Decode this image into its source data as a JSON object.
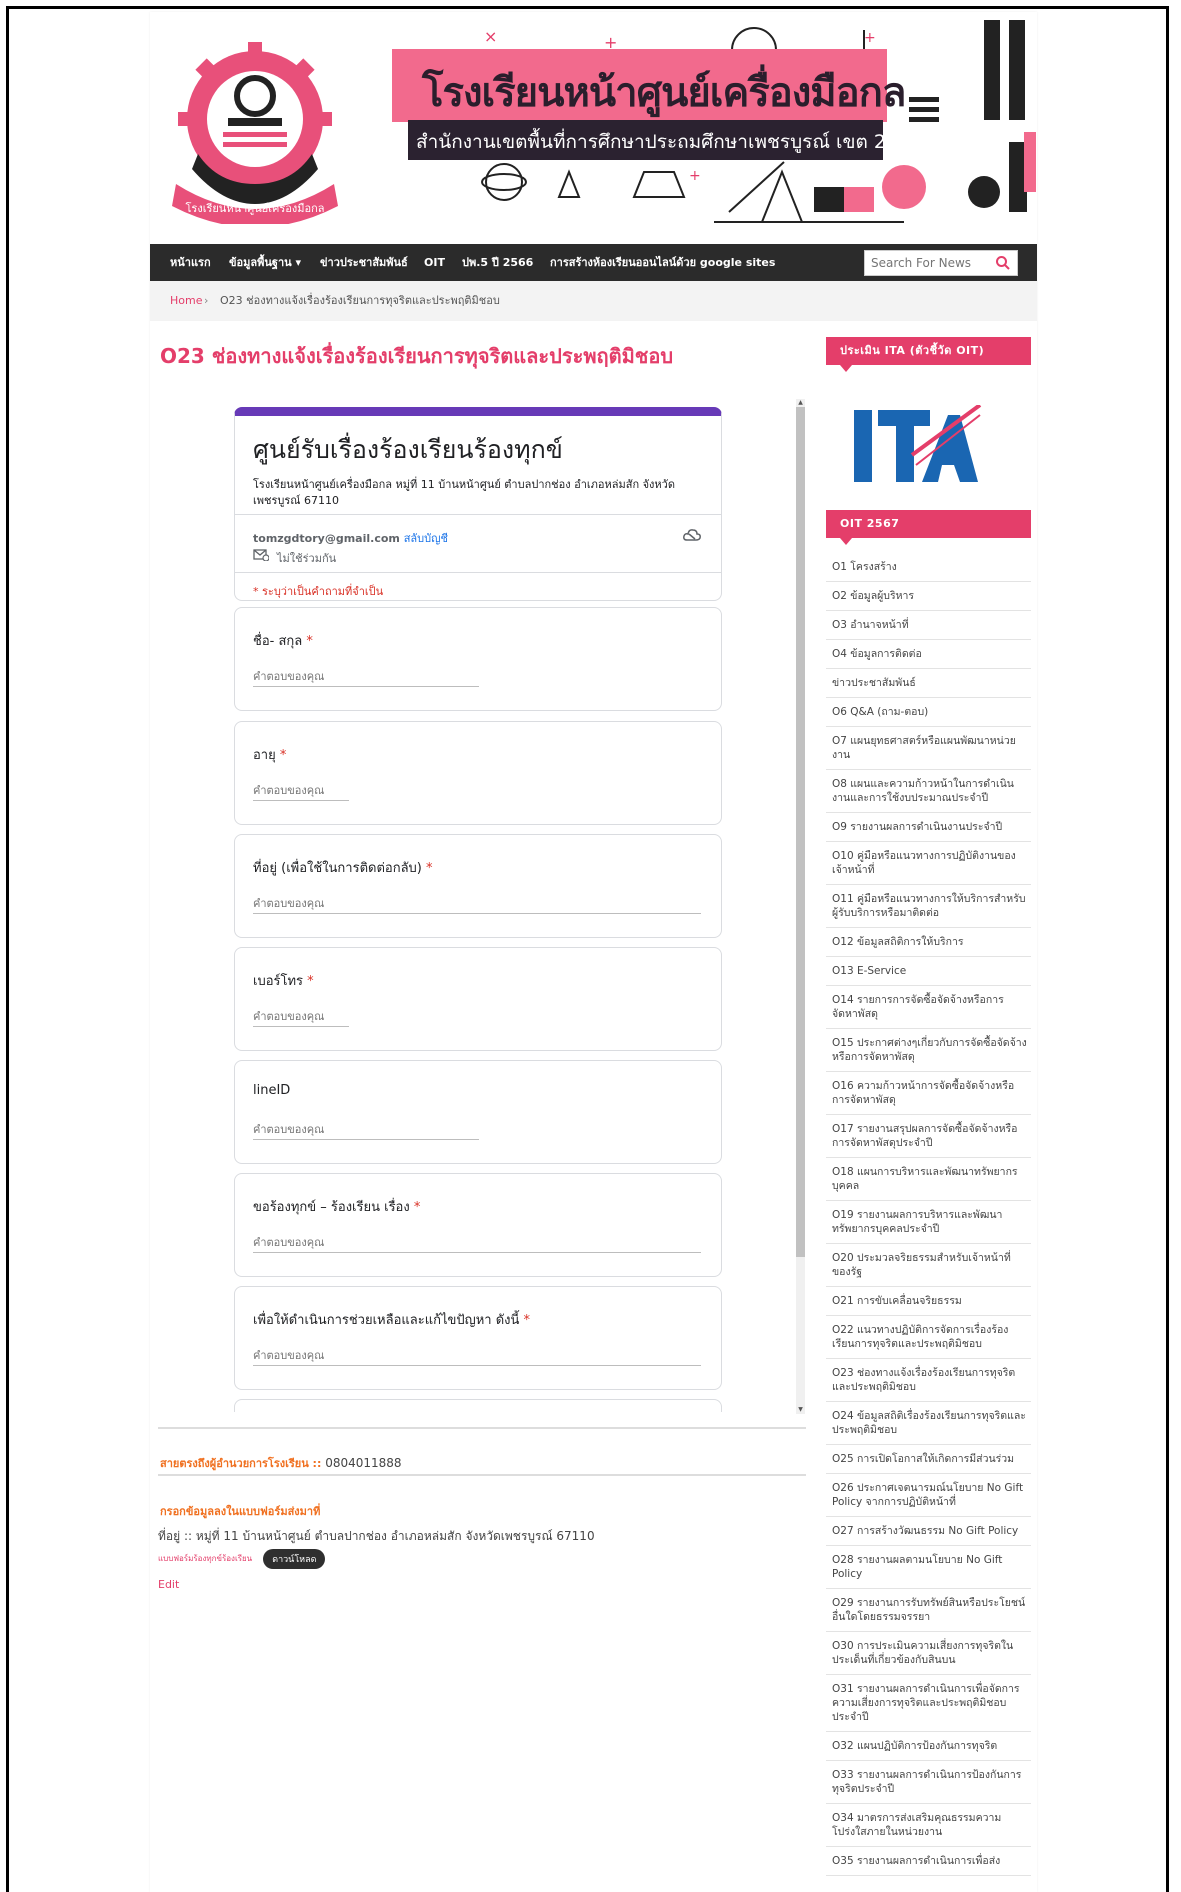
{
  "header": {
    "school_name": "โรงเรียนหน้าศูนย์เครื่องมือกล",
    "subtitle": "สำนักงานเขตพื้นที่การศึกษาประถมศึกษาเพชรบูรณ์ เขต 2",
    "logo_caption": "โรงเรียนหน้าศูนย์เครื่องมือกล"
  },
  "nav": {
    "items": [
      {
        "label": "หน้าแรก"
      },
      {
        "label": "ข้อมูลพื้นฐาน ▾"
      },
      {
        "label": "ข่าวประชาสัมพันธ์"
      },
      {
        "label": "OIT"
      },
      {
        "label": "ปพ.5 ปี 2566"
      },
      {
        "label": "การสร้างห้องเรียนออนไลน์ด้วย google sites"
      }
    ],
    "search_placeholder": "Search For News"
  },
  "breadcrumb": {
    "home": "Home",
    "separator": "›",
    "current": "O23 ช่องทางแจ้งเรื่องร้องเรียนการทุจริตและประพฤติมิชอบ"
  },
  "page_title": "O23 ช่องทางแจ้งเรื่องร้องเรียนการทุจริตและประพฤติมิชอบ",
  "form": {
    "title": "ศูนย์รับเรื่องร้องเรียนร้องทุกข์",
    "description": "โรงเรียนหน้าศูนย์เครื่องมือกล หมู่ที่ 11 บ้านหน้าศูนย์ ตำบลปากช่อง อำเภอหล่มสัก จังหวัดเพชรบูรณ์ 67110",
    "email": "tomzgdtory@gmail.com",
    "switch_account": "สลับบัญชี",
    "not_shared": "ไม่ใช้ร่วมกัน",
    "required_note": "* ระบุว่าเป็นคำถามที่จำเป็น",
    "answer_placeholder": "คำตอบของคุณ",
    "questions": [
      {
        "label": "ชื่อ- สกุล",
        "required": "*"
      },
      {
        "label": "อายุ",
        "required": "*"
      },
      {
        "label": "ที่อยู่ (เพื่อใช้ในการติดต่อกลับ)",
        "required": "*"
      },
      {
        "label": "เบอร์โทร",
        "required": "*"
      },
      {
        "label": "lineID",
        "required": ""
      },
      {
        "label": "ขอร้องทุกข์ – ร้องเรียน เรื่อง",
        "required": "*"
      },
      {
        "label": "เพื่อให้ดำเนินการช่วยเหลือและแก้ไขปัญหา ดังนี้",
        "required": "*"
      }
    ]
  },
  "footer": {
    "contact_label": "สายตรงถึงผู้อำนวยการโรงเรียน ::",
    "contact_number": "0804011888",
    "fill_note": "กรอกข้อมูลลงในแบบฟอร์มส่งมาที่",
    "address": "ที่อยู่ :: หมู่ที่ 11 บ้านหน้าศูนย์ ตำบลปากช่อง อำเภอหล่มสัก จังหวัดเพชรบูรณ์ 67110",
    "file_link": "แบบฟอร์มร้องทุกข์ร้องเรียน",
    "download_label": "ดาวน์โหลด",
    "edit_label": "Edit"
  },
  "sidebar": {
    "ita_heading": "ประเมิน ITA (ตัวชี้วัด OIT)",
    "oit_heading": "OIT 2567",
    "items": [
      "O1 โครงสร้าง",
      "O2 ข้อมูลผู้บริหาร",
      "O3 อำนาจหน้าที่",
      "O4 ข้อมูลการติดต่อ",
      "ข่าวประชาสัมพันธ์",
      "O6 Q&A (ถาม-ตอบ)",
      "O7 แผนยุทธศาสตร์หรือแผนพัฒนาหน่วยงาน",
      "O8 แผนและความก้าวหน้าในการดำเนินงานและการใช้งบประมาณประจำปี",
      "O9 รายงานผลการดำเนินงานประจำปี",
      "O10 คู่มือหรือแนวทางการปฏิบัติงานของเจ้าหน้าที่",
      "O11 คู่มือหรือแนวทางการให้บริการสำหรับผู้รับบริการหรือมาติดต่อ",
      "O12 ข้อมูลสถิติการให้บริการ",
      "O13 E-Service",
      "O14 รายการการจัดซื้อจัดจ้างหรือการจัดหาพัสดุ",
      "O15 ประกาศต่างๆเกี่ยวกับการจัดซื้อจัดจ้างหรือการจัดหาพัสดุ",
      "O16 ความก้าวหน้าการจัดซื้อจัดจ้างหรือการจัดหาพัสดุ",
      "O17 รายงานสรุปผลการจัดซื้อจัดจ้างหรือการจัดหาพัสดุประจำปี",
      "O18 แผนการบริหารและพัฒนาทรัพยากรบุคคล",
      "O19 รายงานผลการบริหารและพัฒนาทรัพยากรบุคคลประจำปี",
      "O20 ประมวลจริยธรรมสำหรับเจ้าหน้าที่ของรัฐ",
      "O21 การขับเคลื่อนจริยธรรม",
      "O22 แนวทางปฏิบัติการจัดการเรื่องร้องเรียนการทุจริตและประพฤติมิชอบ",
      "O23 ช่องทางแจ้งเรื่องร้องเรียนการทุจริตและประพฤติมิชอบ",
      "O24 ข้อมูลสถิติเรื่องร้องเรียนการทุจริตและประพฤติมิชอบ",
      "O25 การเปิดโอกาสให้เกิดการมีส่วนร่วม",
      "O26 ประกาศเจตนารมณ์นโยบาย No Gift Policy จากการปฏิบัติหน้าที่",
      "O27 การสร้างวัฒนธรรม No Gift Policy",
      "O28 รายงานผลตามนโยบาย No Gift Policy",
      "O29 รายงานการรับทรัพย์สินหรือประโยชน์อื่นใดโดยธรรมจรรยา",
      "O30 การประเมินความเสี่ยงการทุจริตในประเด็นที่เกี่ยวข้องกับสินบน",
      "O31 รายงานผลการดำเนินการเพื่อจัดการความเสี่ยงการทุจริตและประพฤติมิชอบประจำปี",
      "O32 แผนปฏิบัติการป้องกันการทุจริต",
      "O33 รายงานผลการดำเนินการป้องกันการทุจริตประจำปี",
      "O34 มาตรการส่งเสริมคุณธรรมความโปร่งใสภายในหน่วยงาน",
      "O35 รายงานผลการดำเนินการเพื่อส่ง"
    ]
  }
}
